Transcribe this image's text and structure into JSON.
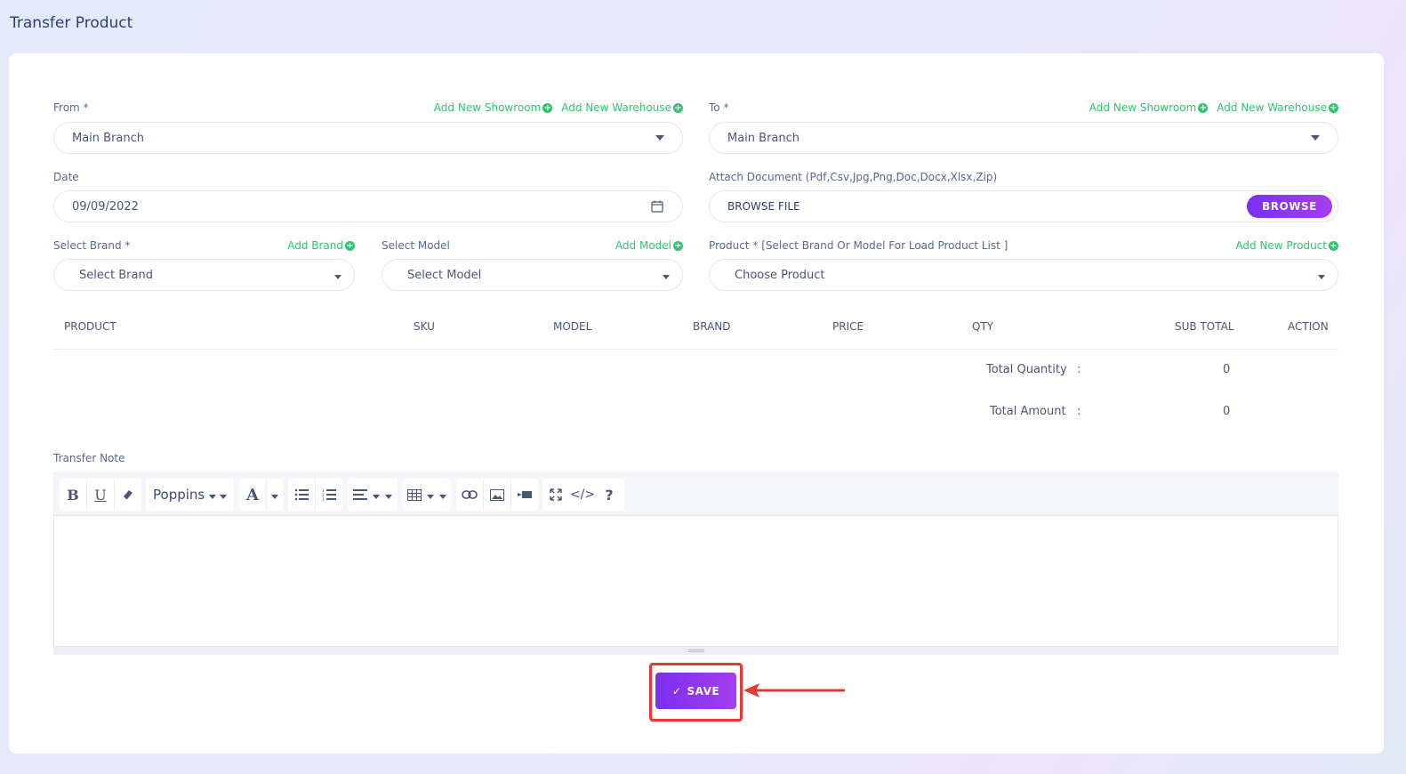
{
  "page": {
    "title": "Transfer Product"
  },
  "from": {
    "label": "From *",
    "add_showroom": "Add New Showroom",
    "add_warehouse": "Add New Warehouse",
    "value": "Main Branch"
  },
  "to": {
    "label": "To *",
    "add_showroom": "Add New Showroom",
    "add_warehouse": "Add New Warehouse",
    "value": "Main Branch"
  },
  "date": {
    "label": "Date",
    "value": "09/09/2022"
  },
  "attach": {
    "label": "Attach Document (Pdf,Csv,Jpg,Png,Doc,Docx,Xlsx,Zip)",
    "file_text": "BROWSE FILE",
    "browse_label": "BROWSE"
  },
  "brand": {
    "label": "Select Brand *",
    "add_label": "Add Brand",
    "placeholder": "Select Brand"
  },
  "model": {
    "label": "Select Model",
    "add_label": "Add Model",
    "placeholder": "Select Model"
  },
  "product": {
    "label": "Product * [Select Brand Or Model For Load Product List ]",
    "add_label": "Add New Product",
    "placeholder": "Choose Product"
  },
  "table": {
    "headers": [
      "PRODUCT",
      "SKU",
      "MODEL",
      "BRAND",
      "PRICE",
      "QTY",
      "SUB TOTAL",
      "ACTION"
    ]
  },
  "totals": {
    "quantity_label": "Total Quantity",
    "quantity_value": "0",
    "amount_label": "Total Amount",
    "amount_value": "0",
    "separator": ":"
  },
  "note": {
    "label": "Transfer Note",
    "font_name": "Poppins",
    "toolbar_icons": [
      "bold-icon",
      "underline-icon",
      "eraser-icon",
      "font-color-icon",
      "unordered-list-icon",
      "ordered-list-icon",
      "align-icon",
      "table-icon",
      "link-icon",
      "image-icon",
      "video-icon",
      "fullscreen-icon",
      "code-view-icon",
      "help-icon"
    ]
  },
  "save": {
    "label": "SAVE"
  },
  "colors": {
    "accent": "#8a35f0",
    "link_green": "#2fc56f",
    "highlight_red": "#e53935"
  }
}
